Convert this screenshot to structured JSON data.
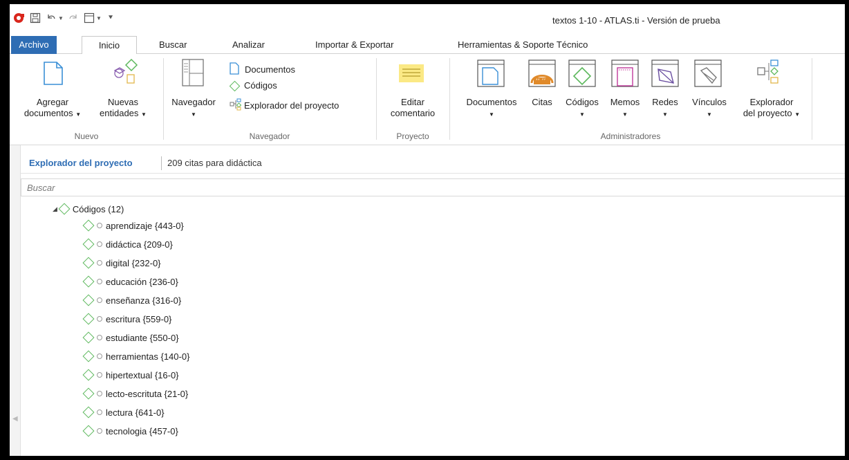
{
  "window": {
    "title": "textos 1-10 - ATLAS.ti - Versión de prueba"
  },
  "tabs": [
    "Archivo",
    "Inicio",
    "Buscar",
    "Analizar",
    "Importar & Exportar",
    "Herramientas & Soporte Técnico"
  ],
  "ribbon": {
    "nuevo": {
      "label": "Nuevo",
      "agregar_l1": "Agregar",
      "agregar_l2": "documentos",
      "nuevas_l1": "Nuevas",
      "nuevas_l2": "entidades"
    },
    "navegador": {
      "label": "Navegador",
      "btn": "Navegador",
      "documentos": "Documentos",
      "codigos": "Códigos",
      "explorador": "Explorador del proyecto"
    },
    "proyecto": {
      "label": "Proyecto",
      "editar_l1": "Editar",
      "editar_l2": "comentario"
    },
    "administradores": {
      "label": "Administradores",
      "documentos": "Documentos",
      "citas": "Citas",
      "codigos": "Códigos",
      "memos": "Memos",
      "redes": "Redes",
      "vinculos": "Vínculos",
      "explorador_l1": "Explorador",
      "explorador_l2": "del proyecto"
    }
  },
  "explorer": {
    "title": "Explorador del proyecto",
    "subtitle": "209 citas para didáctica",
    "search_placeholder": "Buscar",
    "root": "Códigos (12)",
    "codes": [
      "aprendizaje {443-0}",
      "didáctica {209-0}",
      "digital {232-0}",
      "educación {236-0}",
      "enseñanza {316-0}",
      "escritura {559-0}",
      "estudiante {550-0}",
      "herramientas {140-0}",
      "hipertextual {16-0}",
      "lecto-escrituta {21-0}",
      "lectura {641-0}",
      "tecnologia {457-0}"
    ]
  },
  "colors": {
    "accent": "#2e6db4",
    "code_green": "#5cb85c"
  }
}
